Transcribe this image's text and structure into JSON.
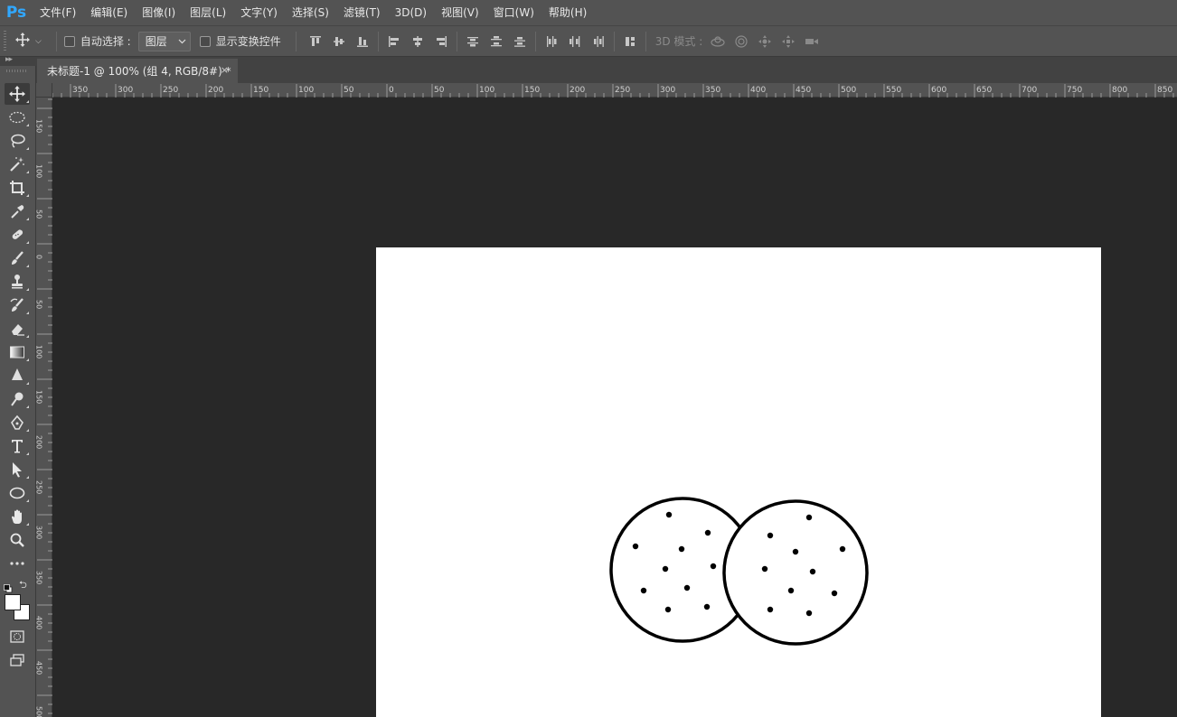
{
  "app": {
    "logo": "Ps"
  },
  "menu": [
    {
      "label": "文件(F)"
    },
    {
      "label": "编辑(E)"
    },
    {
      "label": "图像(I)"
    },
    {
      "label": "图层(L)"
    },
    {
      "label": "文字(Y)"
    },
    {
      "label": "选择(S)"
    },
    {
      "label": "滤镜(T)"
    },
    {
      "label": "3D(D)"
    },
    {
      "label": "视图(V)"
    },
    {
      "label": "窗口(W)"
    },
    {
      "label": "帮助(H)"
    }
  ],
  "options": {
    "auto_select_label": "自动选择 :",
    "auto_select_checked": false,
    "layer_select_value": "图层",
    "show_transform_label": "显示变换控件",
    "show_transform_checked": false,
    "mode_3d_label": "3D 模式 :"
  },
  "document": {
    "tab_title": "未标题-1 @ 100% (组 4, RGB/8#) *",
    "close_glyph": "×"
  },
  "ruler": {
    "h_labels": [
      "350",
      "300",
      "250",
      "200",
      "150",
      "100",
      "50",
      "0",
      "50",
      "100",
      "150",
      "200",
      "250",
      "300",
      "350",
      "400",
      "450",
      "500",
      "550",
      "600",
      "650",
      "700",
      "750",
      "800",
      "850"
    ],
    "v_labels": [
      "150",
      "100",
      "50",
      "0",
      "50",
      "100",
      "150",
      "200",
      "250",
      "300",
      "350",
      "400",
      "450",
      "500"
    ]
  },
  "colors": {
    "foreground": "#ffffff",
    "background": "#ffffff",
    "accent": "#31a8ff"
  },
  "artwork": {
    "description_shape": "two-overlapping-dotted-circles"
  }
}
